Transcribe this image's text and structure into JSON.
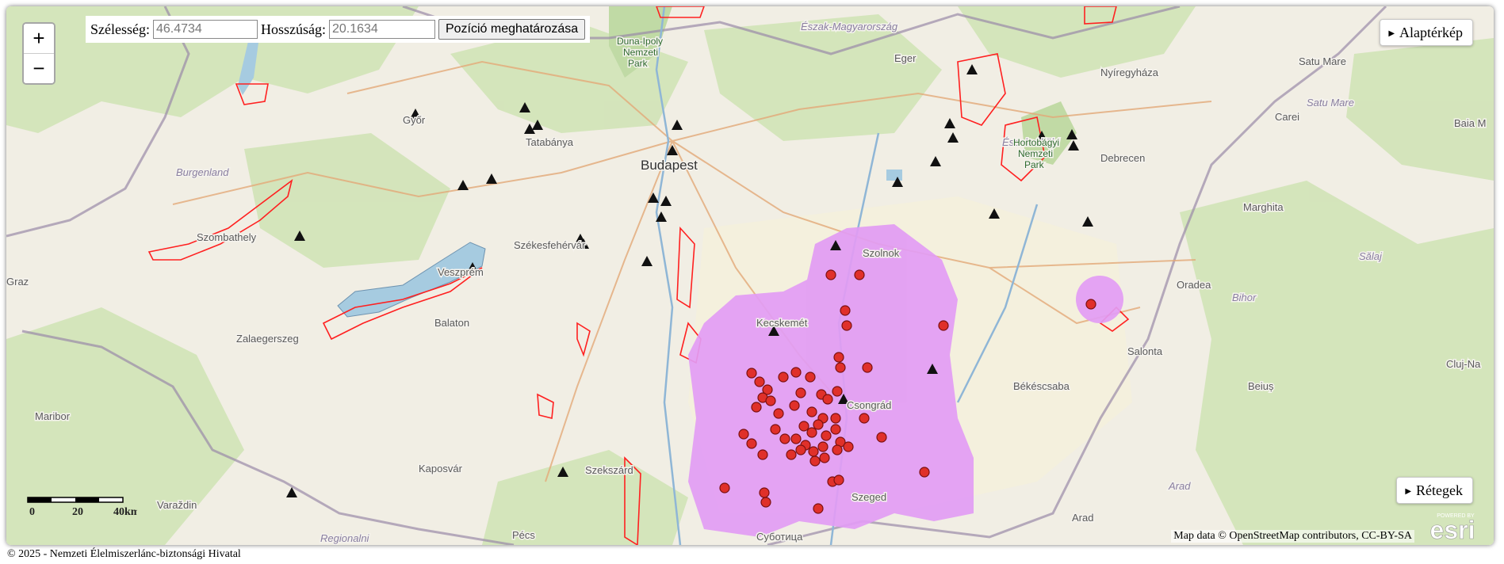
{
  "search": {
    "lat_label": "Szélesség:",
    "lat_value": "46.4734",
    "lon_label": "Hosszúság:",
    "lon_value": "20.1634",
    "locate_label": "Pozíció meghatározása"
  },
  "zoom": {
    "in_label": "+",
    "out_label": "−"
  },
  "controls": {
    "basemap_label": "Alaptérkép",
    "layers_label": "Rétegek"
  },
  "scale": {
    "ticks": [
      "0",
      "20",
      "40km"
    ]
  },
  "attribution": "Map data © OpenStreetMap contributors, CC-BY-SA",
  "esri": {
    "powered": "POWERED BY",
    "brand": "esri"
  },
  "footer": "© 2025 - Nemzeti Élelmiszerlánc-biztonsági Hivatal",
  "colors": {
    "zone_fill": "#e29cf4",
    "outbreak_marker": "#e0302a",
    "protected_area_outline": "#ff2020",
    "lake_fill": "#a6cbe0",
    "triangle_marker": "#111111"
  },
  "map_labels": {
    "budapest": "Budapest",
    "gyor": "Győr",
    "tatabanya": "Tatabánya",
    "eger": "Eger",
    "nyiregyhaza": "Nyíregyháza",
    "debrecen": "Debrecen",
    "szombathely": "Szombathely",
    "szekesfehervar": "Székesfehérvár",
    "veszprem": "Veszprém",
    "zalaegerszeg": "Zalaegerszeg",
    "kaposvar": "Kaposvár",
    "szekszard": "Szekszárd",
    "pecs": "Pécs",
    "kecskemet": "Kecskemét",
    "szolnok": "Szolnok",
    "szeged": "Szeged",
    "bekescsaba": "Békéscsaba",
    "oradea": "Oradea",
    "salonta": "Salonta",
    "arad": "Arad",
    "cluj": "Cluj-Na",
    "satu_mare": "Satu Mare",
    "carei": "Carei",
    "baia_m": "Baia M",
    "marghita": "Marghita",
    "beius": "Beiuș",
    "subotica": "Суботица",
    "maribor": "Maribor",
    "varazdin": "Varaždin",
    "graz": "Graz",
    "bihor": "Bihor",
    "salaj": "Sălaj",
    "satu_mare_region": "Satu Mare",
    "burgenland": "Burgenland",
    "eszak_alfold": "Észak-Alföld",
    "eszak_mo": "Észak-Magyarország",
    "arad_region": "Arad",
    "regionalni": "Regionalni",
    "duna_ipoly": "Duna-Ipoly",
    "nemzeti": "Nemzeti",
    "park": "Park",
    "hortobagy": "Hortobágyi",
    "hort_nemzeti": "Nemzeti",
    "hort_park": "Park",
    "balaton": "Balaton",
    "csongrad": "Csongrád"
  }
}
